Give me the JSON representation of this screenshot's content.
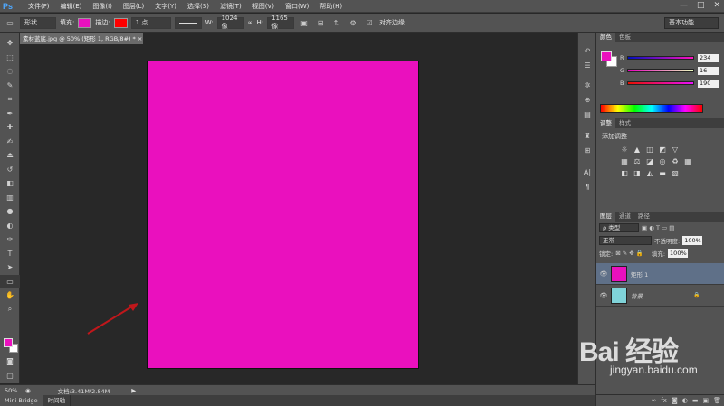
{
  "app": {
    "logo": "Ps",
    "win_min": "—",
    "win_max": "□",
    "win_close": "✕"
  },
  "menu": [
    "文件(F)",
    "编辑(E)",
    "图像(I)",
    "图层(L)",
    "文字(Y)",
    "选择(S)",
    "滤镜(T)",
    "视图(V)",
    "窗口(W)",
    "帮助(H)"
  ],
  "options": {
    "mode": "形状",
    "fill_label": "填充:",
    "fill_color": "#ea10be",
    "stroke_label": "描边:",
    "stroke_color": "#ff0000",
    "stroke_width": "1 点",
    "w_label": "W:",
    "w_value": "1024 像",
    "link_glyph": "∞",
    "h_label": "H:",
    "h_value": "1165 像",
    "align_label": "对齐边缘",
    "workspace": "基本功能"
  },
  "document": {
    "tab_title": "素材蓝底.jpg @ 50% (矩形 1, RGB/8#) *",
    "tab_close": "×",
    "canvas_color": "#ea10be"
  },
  "status": {
    "zoom": "50%",
    "doc_info": "文档:3.41M/2.84M",
    "next_arrow": "▶"
  },
  "bottom_tabs": [
    "Mini Bridge",
    "时间轴"
  ],
  "color_panel": {
    "tabs": [
      "颜色",
      "色板"
    ],
    "r_label": "R",
    "r_value": "234",
    "g_label": "G",
    "g_value": "16",
    "b_label": "B",
    "b_value": "190"
  },
  "adjust_panel": {
    "tabs": [
      "调整",
      "样式"
    ],
    "title": "添加调整"
  },
  "layers_panel": {
    "tabs": [
      "图层",
      "通道",
      "路径"
    ],
    "filter": "ρ 类型",
    "blend_mode": "正常",
    "opacity_label": "不透明度:",
    "opacity_value": "100%",
    "lock_label": "锁定:",
    "fill_label": "填充:",
    "fill_value": "100%",
    "layers": [
      {
        "name": "矩形 1",
        "visible_glyph": "👁"
      },
      {
        "name": "背景",
        "visible_glyph": "👁",
        "lock_glyph": "🔒"
      }
    ]
  },
  "watermark": {
    "logo": "Bai 经验",
    "url": "jingyan.baidu.com"
  }
}
